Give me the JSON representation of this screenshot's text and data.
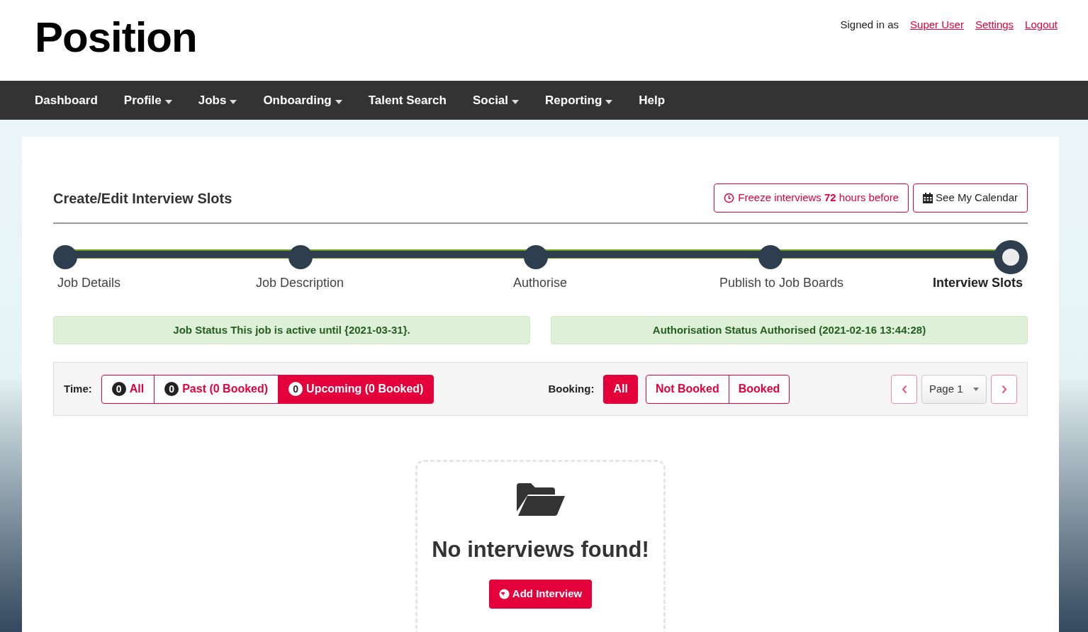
{
  "logo": "Position",
  "user_bar": {
    "signed_in_label": "Signed in as",
    "links": [
      "Super User",
      "Settings",
      "Logout"
    ]
  },
  "nav": [
    {
      "label": "Dashboard",
      "dropdown": false
    },
    {
      "label": "Profile",
      "dropdown": true
    },
    {
      "label": "Jobs",
      "dropdown": true
    },
    {
      "label": "Onboarding",
      "dropdown": true
    },
    {
      "label": "Talent Search",
      "dropdown": false
    },
    {
      "label": "Social",
      "dropdown": true
    },
    {
      "label": "Reporting",
      "dropdown": true
    },
    {
      "label": "Help",
      "dropdown": false
    }
  ],
  "page_title": "Create/Edit Interview Slots",
  "header_buttons": {
    "freeze": "Freeze interviews **72** hours before",
    "calendar": "See My Calendar"
  },
  "steps": [
    {
      "label": "Job Details",
      "selected": false
    },
    {
      "label": "Job Description",
      "selected": false
    },
    {
      "label": "Authorise",
      "selected": false
    },
    {
      "label": "Publish to Job Boards",
      "selected": false
    },
    {
      "label": "Interview Slots",
      "selected": true
    }
  ],
  "alerts": [
    "Job Status This job is active until {2021-03-31}.",
    "Authorisation Status Authorised (2021-02-16 13:44:28)"
  ],
  "time_filter": {
    "label": "Time:",
    "options": [
      {
        "count": "0",
        "label": "All",
        "selected": false
      },
      {
        "count": "0",
        "label": "Past (0 Booked)",
        "selected": false
      },
      {
        "count": "0",
        "label": "Upcoming (0 Booked)",
        "selected": true
      }
    ]
  },
  "booking_filter": {
    "label": "Booking:",
    "options": [
      {
        "label": "All",
        "selected": true
      },
      {
        "label": "Not Booked",
        "selected": false
      },
      {
        "label": "Booked",
        "selected": false
      }
    ]
  },
  "pagination": {
    "page": "Page 1"
  },
  "empty_state": {
    "message": "No interviews found!",
    "button": "Add Interview"
  }
}
